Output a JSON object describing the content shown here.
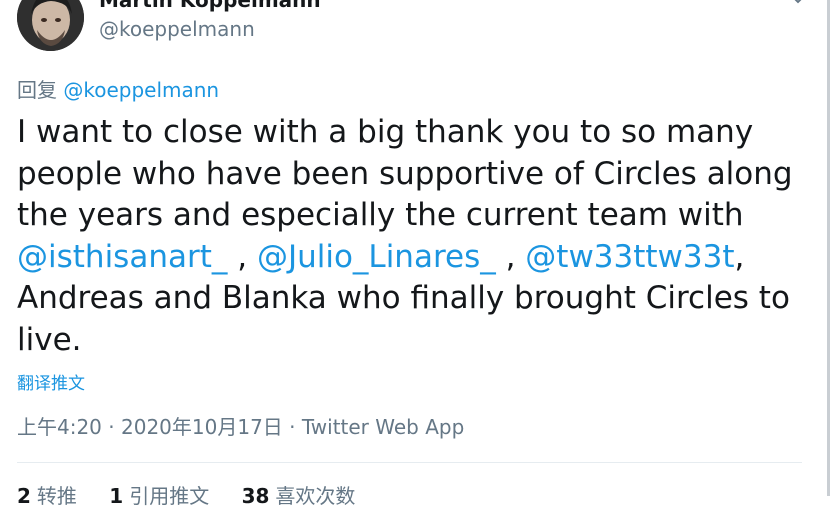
{
  "author": {
    "display_name": "Martin Köppelmann",
    "handle": "@koeppelmann"
  },
  "reply": {
    "prefix": "回复",
    "mention": "@koeppelmann"
  },
  "tweet": {
    "part1": "I want to close with a big thank you to so many people who have been supportive of Circles along the years and especially the current team with ",
    "mention1": "@isthisanart_",
    "sep1": " , ",
    "mention2": "@Julio_Linares_",
    "sep2": " , ",
    "mention3": "@tw33ttw33t",
    "part2": ", Andreas and Blanka who finally brought Circles to live."
  },
  "translate_label": "翻译推文",
  "meta": {
    "time": "上午4:20",
    "sep1": " · ",
    "date": "2020年10月17日",
    "sep2": " · ",
    "source": "Twitter Web App"
  },
  "stats": [
    {
      "count": "2",
      "label": "转推"
    },
    {
      "count": "1",
      "label": "引用推文"
    },
    {
      "count": "38",
      "label": "喜欢次数"
    }
  ],
  "icons": {
    "avatar": "avatar",
    "more": "chevron-down-icon"
  }
}
